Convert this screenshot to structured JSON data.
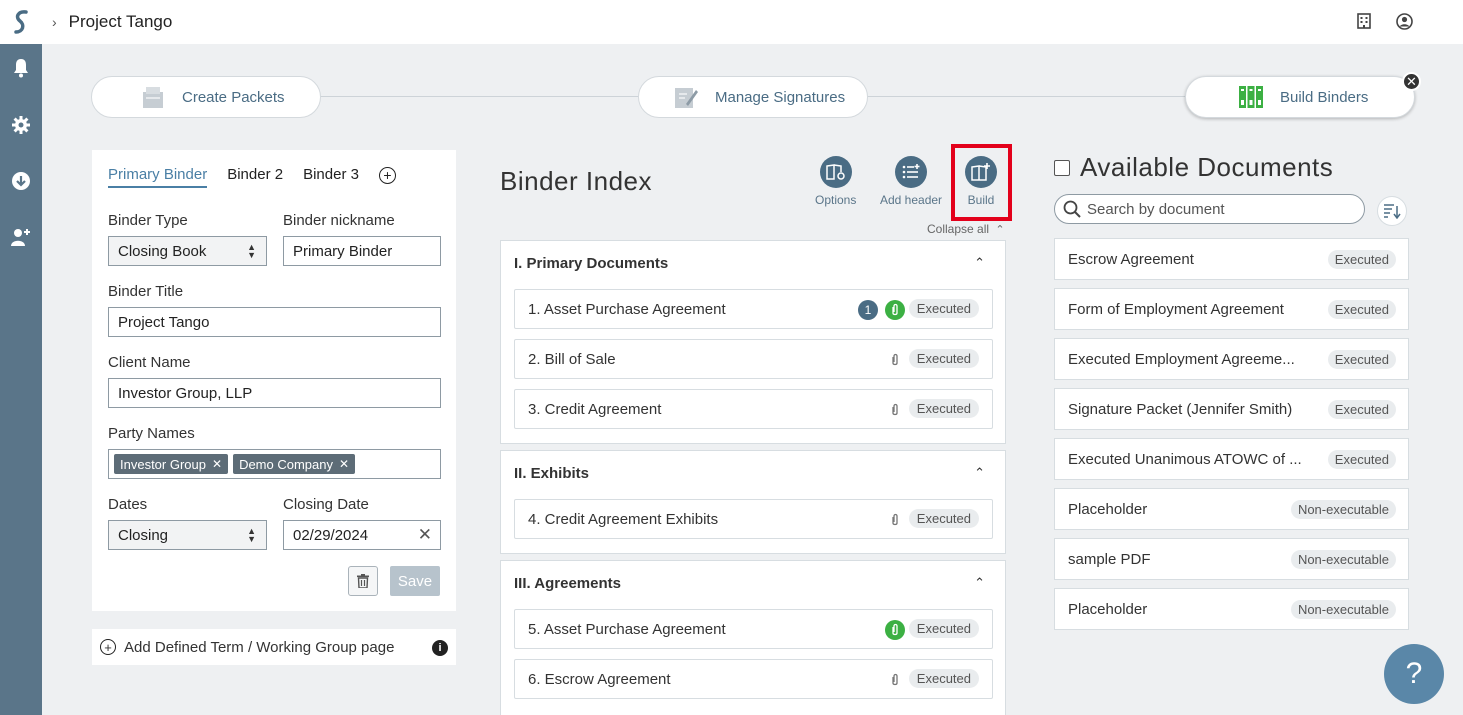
{
  "header": {
    "title": "Project Tango"
  },
  "stepper": [
    {
      "label": "Create Packets"
    },
    {
      "label": "Manage Signatures"
    },
    {
      "label": "Build Binders"
    }
  ],
  "left": {
    "tabs": [
      "Primary Binder",
      "Binder 2",
      "Binder 3"
    ],
    "binder_type_label": "Binder Type",
    "binder_type_value": "Closing Book",
    "nickname_label": "Binder nickname",
    "nickname_value": "Primary Binder",
    "title_label": "Binder Title",
    "title_value": "Project Tango",
    "client_label": "Client Name",
    "client_value": "Investor Group, LLP",
    "party_label": "Party Names",
    "parties": [
      "Investor Group",
      "Demo Company"
    ],
    "dates_label": "Dates",
    "dates_value": "Closing",
    "closing_date_label": "Closing Date",
    "closing_date_value": "02/29/2024",
    "save_label": "Save",
    "defined_term_label": "Add Defined Term / Working Group page"
  },
  "index": {
    "title": "Binder Index",
    "tools": [
      "Options",
      "Add header",
      "Build"
    ],
    "collapse_label": "Collapse all",
    "status_label": "Executed",
    "sections": [
      {
        "heading": "I. Primary Documents",
        "docs": [
          "1. Asset Purchase Agreement",
          "2. Bill of Sale",
          "3. Credit Agreement"
        ]
      },
      {
        "heading": "II. Exhibits",
        "docs": [
          "4. Credit Agreement Exhibits"
        ]
      },
      {
        "heading": "III. Agreements",
        "docs": [
          "5. Asset Purchase Agreement",
          "6. Escrow Agreement"
        ]
      }
    ],
    "count_badge": "1"
  },
  "available": {
    "title": "Available Documents",
    "search_placeholder": "Search by document",
    "docs": [
      {
        "name": "Escrow Agreement",
        "status": "Executed"
      },
      {
        "name": "Form of Employment Agreement",
        "status": "Executed"
      },
      {
        "name": "Executed Employment Agreeme...",
        "status": "Executed"
      },
      {
        "name": "Signature Packet (Jennifer Smith)",
        "status": "Executed"
      },
      {
        "name": "Executed Unanimous ATOWC of ...",
        "status": "Executed"
      },
      {
        "name": "Placeholder",
        "status": "Non-executable"
      },
      {
        "name": "sample PDF",
        "status": "Non-executable"
      },
      {
        "name": "Placeholder",
        "status": "Non-executable"
      }
    ]
  },
  "help_label": "?"
}
